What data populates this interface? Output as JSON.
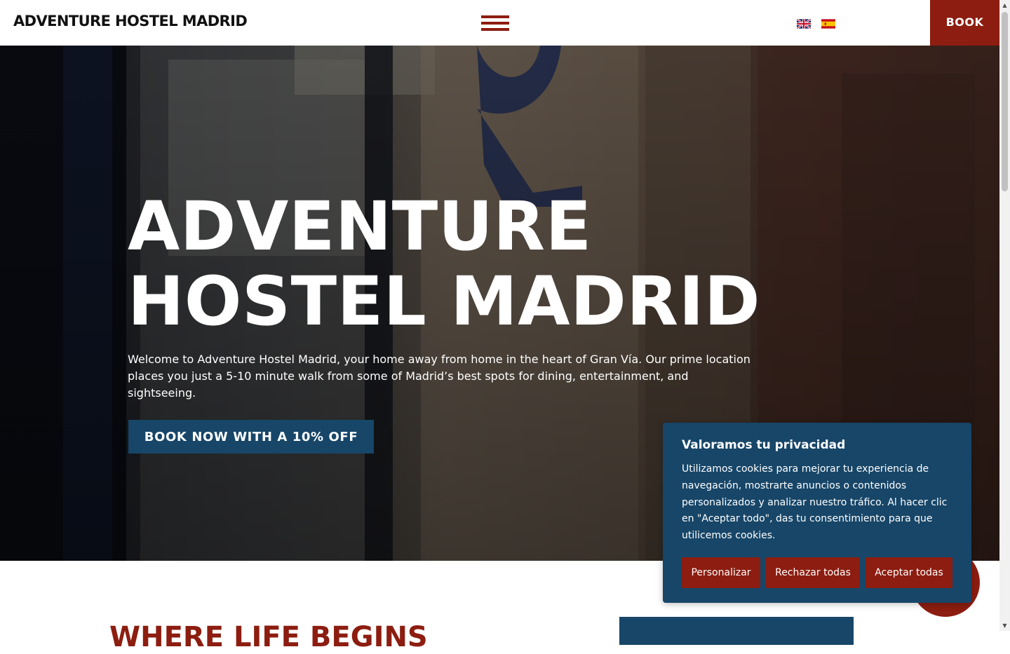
{
  "header": {
    "brand": "ADVENTURE HOSTEL MADRID",
    "book_label": "BOOK",
    "menu_icon": "hamburger-menu-icon",
    "languages": [
      "uk-flag-icon",
      "spain-flag-icon"
    ]
  },
  "hero": {
    "title_line1": "ADVENTURE",
    "title_line2": "HOSTEL MADRID",
    "text": "Welcome to Adventure Hostel Madrid, your home away from home in the heart of Gran Vía. Our prime location places you just a 5-10 minute walk from some of Madrid’s best spots for dining, entertainment, and sightseeing.",
    "cta_label": "BOOK NOW WITH A 10% OFF"
  },
  "section": {
    "title": "WHERE LIFE BEGINS"
  },
  "cookie_banner": {
    "title": "Valoramos tu privacidad",
    "text": "Utilizamos cookies para mejorar tu experiencia de navegación, mostrarte anuncios o contenidos personalizados y analizar nuestro tráfico. Al hacer clic en \"Aceptar todo\", das tu consentimiento para que utilicemos cookies.",
    "customize_label": "Personalizar",
    "reject_label": "Rechazar todas",
    "accept_label": "Aceptar todas"
  },
  "colors": {
    "brand_red": "#8c1d10",
    "brand_blue": "#174668",
    "white": "#ffffff"
  }
}
